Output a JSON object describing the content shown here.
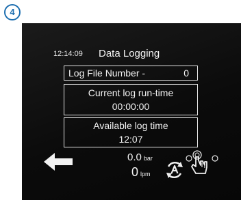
{
  "step_badge": "4",
  "header": {
    "clock": "12:14:09",
    "title": "Data Logging"
  },
  "log_file": {
    "label": "Log File Number -",
    "value": "0"
  },
  "current_runtime": {
    "label": "Current log run-time",
    "value": "00:00:00"
  },
  "available_time": {
    "label": "Available log time",
    "value": "12:07"
  },
  "pressure": {
    "value": "0.0",
    "unit": "bar"
  },
  "flow": {
    "value": "0",
    "unit": "lpm"
  },
  "icons": {
    "back": "back-arrow-icon",
    "auto": "auto-cycle-icon",
    "touch": "touch-hand-icon"
  },
  "colors": {
    "badge": "#1e6fb0",
    "screen_background": "#0b0b0b",
    "screen_text": "#f3f3f3"
  }
}
